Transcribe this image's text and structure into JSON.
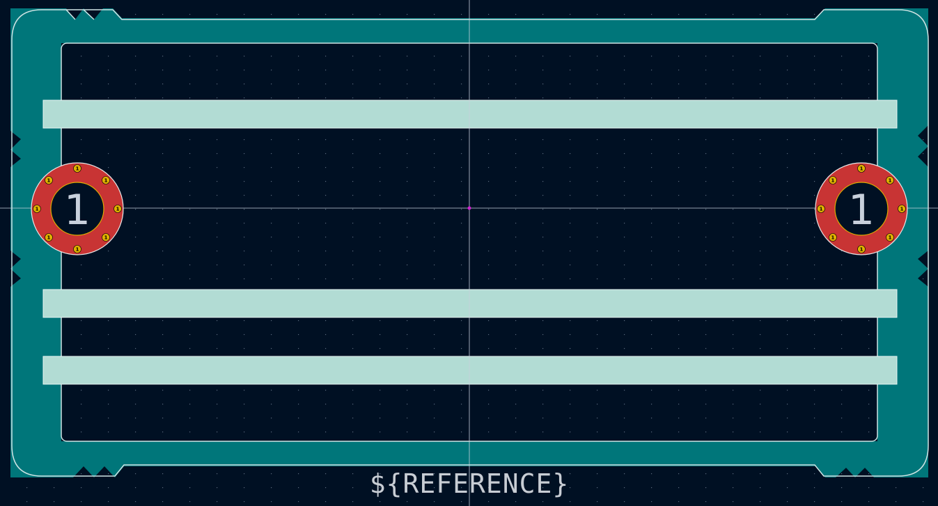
{
  "footprint": {
    "reference_text": "${REFERENCE}",
    "pads": [
      {
        "number": "1",
        "via_number": "1"
      },
      {
        "number": "1",
        "via_number": "1"
      }
    ]
  },
  "colors": {
    "background": "#001023",
    "grid_dot": "#5a6a7e",
    "copper_fill": "#00767a",
    "outline": "#d0e4e4",
    "silk_bars": "#b2dcd4",
    "pad_ring": "#c83434",
    "pad_inner_outline": "#e0b000",
    "crosshair": "#c8d0dc",
    "origin_marker": "#d020d0"
  }
}
